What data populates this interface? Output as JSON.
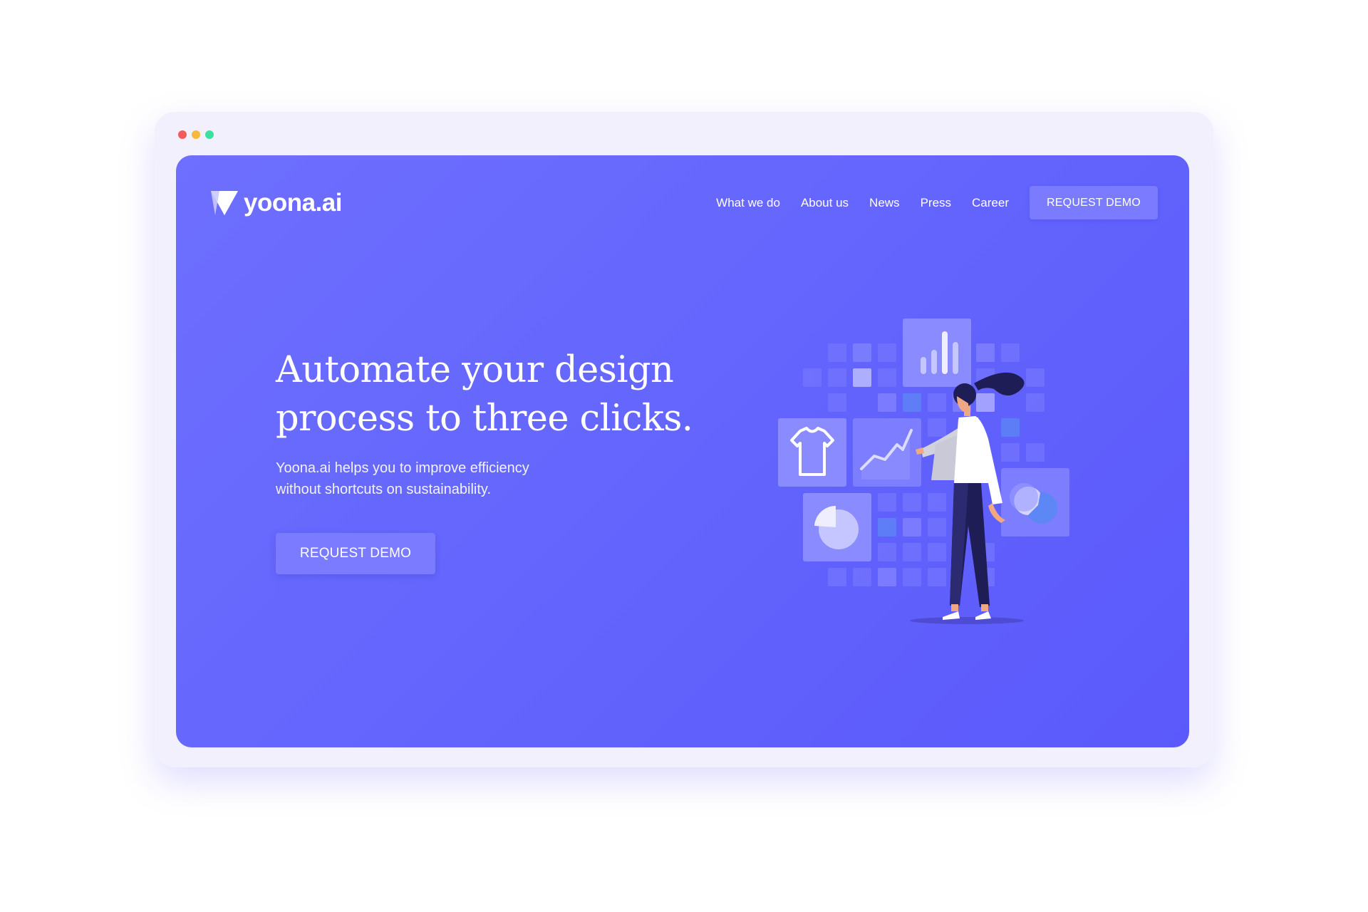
{
  "window": {
    "traffic_lights": [
      {
        "name": "close",
        "color": "#f25c5c"
      },
      {
        "name": "minimize",
        "color": "#f6b93b"
      },
      {
        "name": "zoom",
        "color": "#3ce0a0"
      }
    ]
  },
  "brand": {
    "name": "yoona.ai",
    "logo_icon": "triangle-logo-icon"
  },
  "nav": {
    "links": [
      "What we do",
      "About us",
      "News",
      "Press",
      "Career"
    ],
    "cta_label": "REQUEST DEMO"
  },
  "hero": {
    "title_lines": [
      "Automate your design",
      "process to three clicks."
    ],
    "subtitle_lines": [
      "Yoona.ai helps you to improve efficiency",
      "without shortcuts on sustainability."
    ],
    "cta_label": "REQUEST DEMO"
  },
  "colors": {
    "page_bg_start": "#6e6ffe",
    "page_bg_end": "#5b59fb",
    "button_bg": "#7a7bff",
    "frame_bg": "#f1f0fc"
  },
  "illustration": {
    "icons": [
      "tshirt-icon",
      "bar-chart-icon",
      "line-chart-icon",
      "pie-chart-icon",
      "donut-chart-icon",
      "woman-presenting-figure"
    ]
  }
}
